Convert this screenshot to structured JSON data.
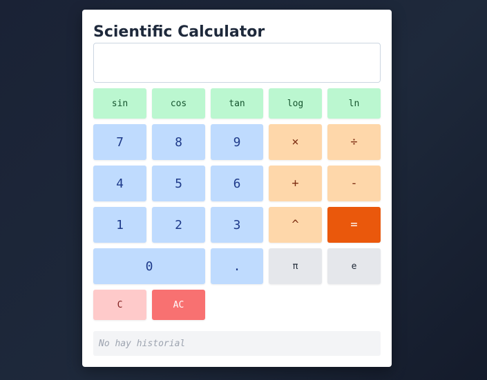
{
  "app": {
    "title": "Scientific Calculator"
  },
  "display": {
    "value": ""
  },
  "functions": {
    "sin": "sin",
    "cos": "cos",
    "tan": "tan",
    "log": "log",
    "ln": "ln"
  },
  "keys": {
    "seven": "7",
    "eight": "8",
    "nine": "9",
    "four": "4",
    "five": "5",
    "six": "6",
    "one": "1",
    "two": "2",
    "three": "3",
    "zero": "0",
    "decimal": ".",
    "multiply": "×",
    "divide": "÷",
    "add": "+",
    "subtract": "-",
    "power": "^",
    "equals": "=",
    "pi": "π",
    "e": "e",
    "clear": "C",
    "all_clear": "AC"
  },
  "history": {
    "empty_text": "No hay historial"
  },
  "colors": {
    "function_bg": "#bbf7d0",
    "number_bg": "#bfdbfe",
    "operator_bg": "#fed7aa",
    "equals_bg": "#ea580c",
    "constant_bg": "#e5e7eb",
    "clear_bg": "#fecaca",
    "all_clear_bg": "#f87171"
  }
}
